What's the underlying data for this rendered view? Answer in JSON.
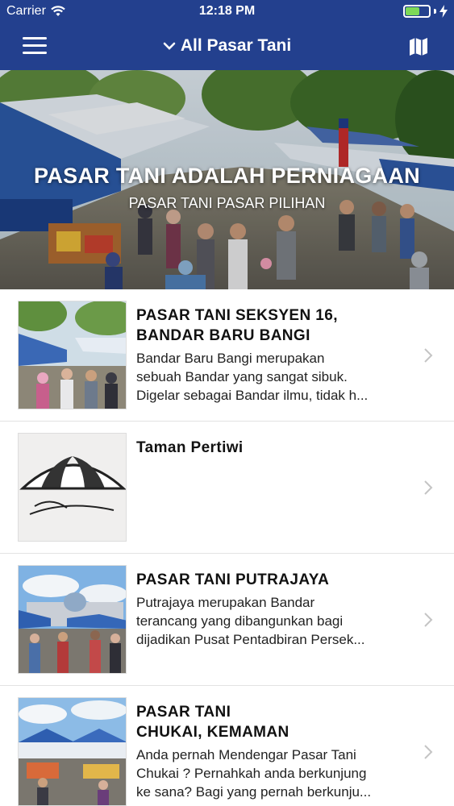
{
  "status_bar": {
    "carrier": "Carrier",
    "time": "12:18 PM"
  },
  "nav": {
    "title": "All Pasar Tani",
    "dropdown_icon": "chevron-down-icon",
    "menu_icon": "hamburger-menu-icon",
    "map_icon": "map-icon"
  },
  "hero": {
    "title": "PASAR TANI ADALAH PERNIAGAAN",
    "subtitle": "PASAR TANI PASAR PILIHAN"
  },
  "markets": [
    {
      "title_lines": [
        "PASAR TANI SEKSYEN 16,",
        "BANDAR BARU BANGI"
      ],
      "description_lines": [
        "Bandar Baru Bangi merupakan",
        "sebuah Bandar yang sangat sibuk.",
        "Digelar sebagai Bandar ilmu, tidak h..."
      ]
    },
    {
      "title_lines": [
        "Taman Pertiwi"
      ],
      "description_lines": [],
      "logo_text": "Pasar Tani"
    },
    {
      "title_lines": [
        "PASAR TANI PUTRAJAYA"
      ],
      "description_lines": [
        "Putrajaya merupakan Bandar",
        "terancang yang dibangunkan bagi",
        "dijadikan Pusat Pentadbiran Persek..."
      ]
    },
    {
      "title_lines": [
        "PASAR TANI",
        "CHUKAI, KEMAMAN"
      ],
      "description_lines": [
        "Anda pernah Mendengar Pasar Tani",
        "Chukai ? Pernahkah anda berkunjung",
        "ke sana? Bagi yang pernah berkunju..."
      ]
    }
  ],
  "colors": {
    "nav_background": "#23408e",
    "battery": "#7dd957",
    "chevron": "#c4c4c4"
  }
}
